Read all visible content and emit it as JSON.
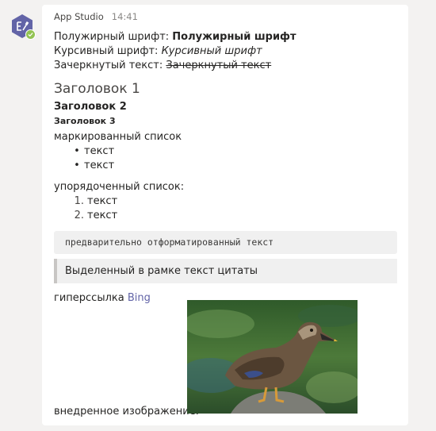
{
  "message": {
    "sender": "App Studio",
    "time": "14:41",
    "bold_line": {
      "label": "Полужирный шрифт: ",
      "value": "Полужирный шрифт"
    },
    "italic_line": {
      "label": "Курсивный шрифт: ",
      "value": "Курсивный шрифт"
    },
    "strike_line": {
      "label": "Зачеркнутый текст: ",
      "value": "Зачеркнутый текст"
    },
    "heading1": "Заголовок 1",
    "heading2": "Заголовок 2",
    "heading3": "Заголовок 3",
    "bulleted_list": {
      "label": "маркированный список",
      "items": [
        "текст",
        "текст"
      ]
    },
    "ordered_list": {
      "label": "упорядоченный список:",
      "items": [
        {
          "num": "1.",
          "text": "текст"
        },
        {
          "num": "2.",
          "text": "текст"
        }
      ]
    },
    "preformatted": "предварительно отформатированный текст",
    "blockquote": "Выделенный в рамке текст цитаты",
    "hyperlink": {
      "label": "гиперссылка ",
      "link_text": "Bing"
    },
    "embedded_image_label": "внедренное изображение:"
  },
  "colors": {
    "accent": "#6264a7",
    "status_available": "#92c353",
    "avatar_bg": "#6264a7"
  },
  "icons": {
    "avatar": "app-studio-icon",
    "status": "check-icon"
  }
}
